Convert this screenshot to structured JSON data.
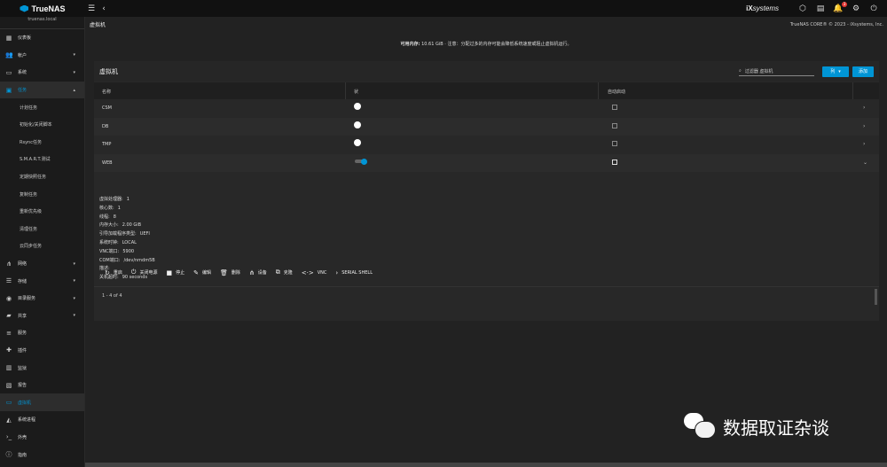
{
  "topbar": {
    "brand": "TrueNAS",
    "vendor_prefix": "iX",
    "vendor": "systems",
    "notification_count": "3",
    "icons": [
      "menu-icon",
      "chevron-left-icon",
      "truecommand-icon",
      "clipboard-icon",
      "bell-icon",
      "gear-icon",
      "power-icon"
    ]
  },
  "sidebar": {
    "hostname": "truenas.local",
    "items": [
      {
        "label": "仪表板",
        "icon": "dashboard-icon",
        "arrow": ""
      },
      {
        "label": "帐户",
        "icon": "people-icon",
        "arrow": "▾"
      },
      {
        "label": "系统",
        "icon": "computer-icon",
        "arrow": "▾"
      },
      {
        "label": "任务",
        "icon": "calendar-icon",
        "arrow": "▴",
        "active": true
      },
      {
        "label": "计划任务",
        "sub": true
      },
      {
        "label": "初始化/关闭脚本",
        "sub": true
      },
      {
        "label": "Rsync任务",
        "sub": true
      },
      {
        "label": "S.M.A.R.T.测试",
        "sub": true
      },
      {
        "label": "定期快照任务",
        "sub": true
      },
      {
        "label": "复制任务",
        "sub": true
      },
      {
        "label": "重新优先级",
        "sub": true
      },
      {
        "label": "清理任务",
        "sub": true
      },
      {
        "label": "云同步任务",
        "sub": true
      },
      {
        "label": "网络",
        "icon": "network-icon",
        "arrow": "▾"
      },
      {
        "label": "存储",
        "icon": "storage-icon",
        "arrow": "▾"
      },
      {
        "label": "目录服务",
        "icon": "directory-icon",
        "arrow": "▾"
      },
      {
        "label": "共享",
        "icon": "folder-icon",
        "arrow": "▾"
      },
      {
        "label": "服务",
        "icon": "tune-icon",
        "arrow": ""
      },
      {
        "label": "插件",
        "icon": "puzzle-icon",
        "arrow": ""
      },
      {
        "label": "监狱",
        "icon": "jail-icon",
        "arrow": ""
      },
      {
        "label": "报告",
        "icon": "report-icon",
        "arrow": ""
      },
      {
        "label": "虚拟机",
        "icon": "laptop-icon",
        "arrow": "",
        "current": true
      },
      {
        "label": "系统进程",
        "icon": "process-icon",
        "arrow": ""
      },
      {
        "label": "外壳",
        "icon": "terminal-icon",
        "arrow": ""
      },
      {
        "label": "指南",
        "icon": "info-icon",
        "arrow": ""
      }
    ]
  },
  "page": {
    "title": "虚拟机",
    "copyright": "TrueNAS CORE® © 2023 - iXsystems, Inc.",
    "notice_label": "可用内存:",
    "notice_text": "10.61 GiB · 注意：分配过多的内存可能会降低系统速度或阻止虚拟机运行。"
  },
  "card": {
    "title": "虚拟机",
    "search_placeholder": "过滤器 虚拟机",
    "columns_button": "列",
    "add_button": "添加",
    "headers": [
      "名称",
      "状",
      "自动启动"
    ],
    "rows": [
      {
        "name": "CSM",
        "running": false,
        "autostart": false
      },
      {
        "name": "DB",
        "running": false,
        "autostart": false
      },
      {
        "name": "TMP",
        "running": false,
        "autostart": false
      },
      {
        "name": "WEB",
        "running": true,
        "autostart": false
      }
    ],
    "details": [
      {
        "k": "虚拟处理器:",
        "v": "1"
      },
      {
        "k": "核心数:",
        "v": "1"
      },
      {
        "k": "线程:",
        "v": "8"
      },
      {
        "k": "内存大小:",
        "v": "2.00 GiB"
      },
      {
        "k": "引导加载程序类型:",
        "v": "UEFI"
      },
      {
        "k": "系统时钟:",
        "v": "LOCAL"
      },
      {
        "k": "VNC端口:",
        "v": "5900"
      },
      {
        "k": "COM端口:",
        "v": "/dev/nmdm5B"
      },
      {
        "k": "描述:",
        "v": ""
      },
      {
        "k": "关机超时:",
        "v": "90 seconds"
      }
    ],
    "actions": [
      {
        "label": "重启",
        "icon": "restart-icon",
        "glyph": "↻"
      },
      {
        "label": "关闭电源",
        "icon": "power-off-icon",
        "glyph": "⏻"
      },
      {
        "label": "停止",
        "icon": "stop-icon",
        "glyph": "■"
      },
      {
        "label": "编辑",
        "icon": "edit-icon",
        "glyph": "✎"
      },
      {
        "label": "删除",
        "icon": "delete-icon",
        "glyph": "🗑"
      },
      {
        "label": "设备",
        "icon": "devices-icon",
        "glyph": "⋔"
      },
      {
        "label": "克隆",
        "icon": "clone-icon",
        "glyph": "⧉"
      },
      {
        "label": "VNC",
        "icon": "vnc-icon",
        "glyph": "<·>"
      },
      {
        "label": "SERIAL SHELL",
        "icon": "chevron-right-icon",
        "glyph": "›"
      }
    ],
    "pagination": "1 - 4 of 4"
  },
  "watermark": "数据取证杂谈",
  "colors": {
    "accent": "#0095d5",
    "background": "#222222",
    "sidebar": "#1b1b1b",
    "topbar": "#111111"
  }
}
